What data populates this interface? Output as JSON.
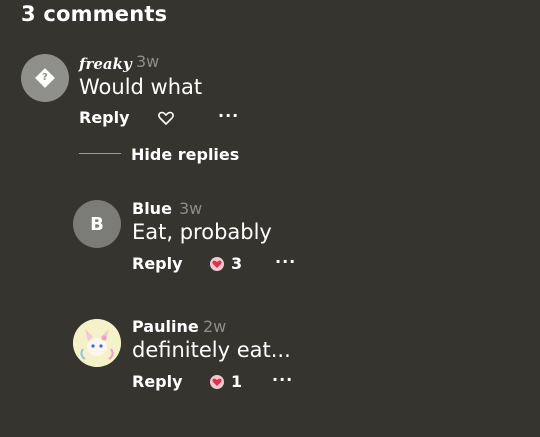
{
  "header": {
    "title": "3 comments"
  },
  "comments": [
    {
      "author": "freaky",
      "time": "3w",
      "text": "Would what",
      "reply_label": "Reply",
      "like_count": "",
      "more": "···"
    }
  ],
  "thread": {
    "hide_replies_label": "Hide replies",
    "replies": [
      {
        "avatar_initial": "B",
        "author": "Blue",
        "time": "3w",
        "text": "Eat, probably",
        "reply_label": "Reply",
        "like_count": "3",
        "more": "···"
      },
      {
        "author": "Pauline",
        "time": "2w",
        "text": "definitely eat...",
        "reply_label": "Reply",
        "like_count": "1",
        "more": "···"
      }
    ]
  },
  "colors": {
    "background": "#35342f",
    "muted_text": "#8e8d87",
    "heart_red": "#e0304a"
  }
}
